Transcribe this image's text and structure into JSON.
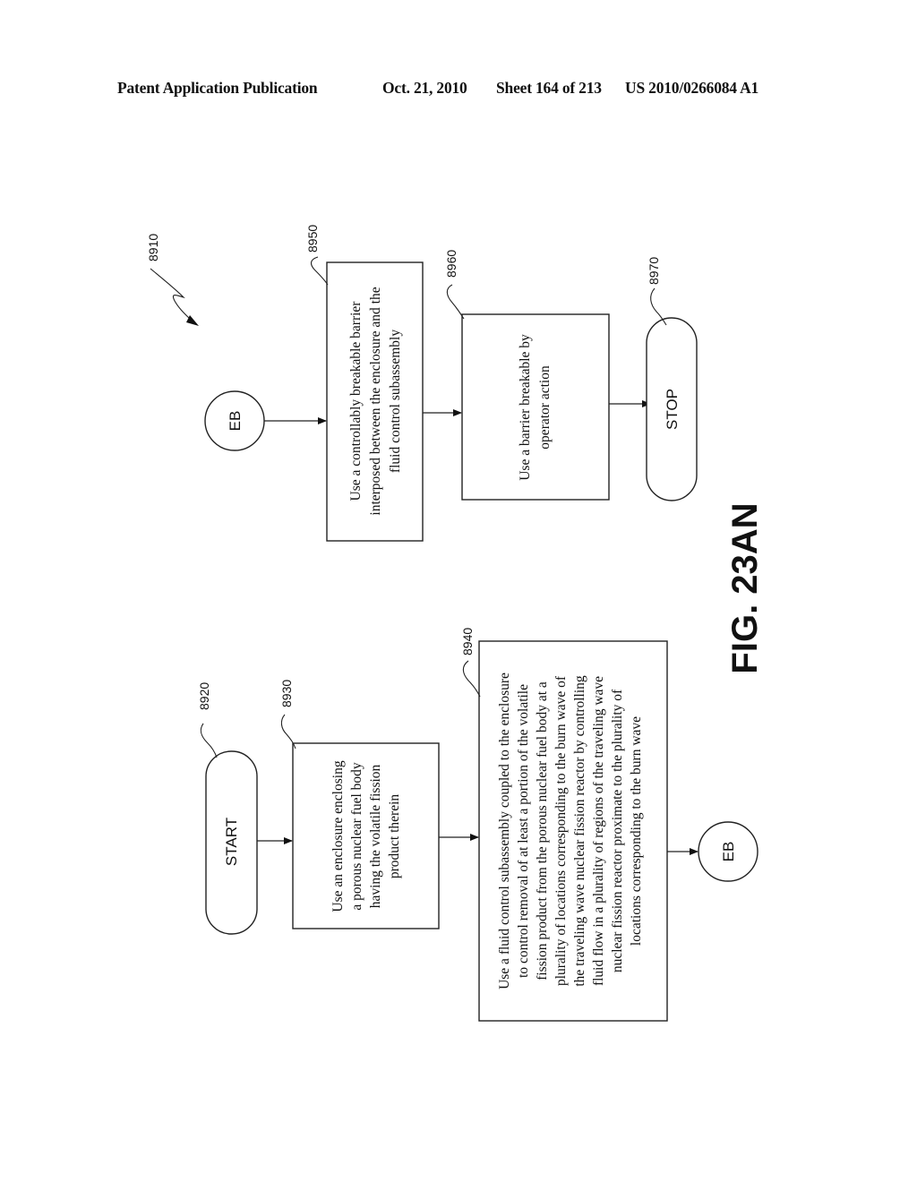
{
  "header": {
    "publication": "Patent Application Publication",
    "date": "Oct. 21, 2010",
    "sheet": "Sheet 164 of 213",
    "number": "US 2010/0266084 A1"
  },
  "figure": {
    "label": "FIG. 23AN",
    "ref": "8910"
  },
  "flow_left": {
    "start": {
      "ref": "8920",
      "label": "START"
    },
    "step_8930": {
      "ref": "8930",
      "lines": [
        "Use an enclosure enclosing",
        "a porous nuclear fuel body",
        "having the volatile fission",
        "product therein"
      ]
    },
    "step_8940": {
      "ref": "8940",
      "lines": [
        "Use a fluid control subassembly coupled to the enclosure",
        "to control removal of at least a portion of the volatile",
        "fission product from the porous nuclear fuel body at a",
        "plurality of locations corresponding to the burn wave of",
        "the traveling wave nuclear fission reactor by controlling",
        "fluid flow in a plurality of regions of the traveling wave",
        "nuclear fission reactor proximate to the plurality of",
        "locations corresponding to the burn wave"
      ]
    },
    "connector_out": {
      "label": "EB"
    }
  },
  "flow_right": {
    "connector_in": {
      "label": "EB"
    },
    "step_8950": {
      "ref": "8950",
      "lines": [
        "Use a controllably breakable barrier",
        "interposed between the enclosure and the",
        "fluid control subassembly"
      ]
    },
    "step_8960": {
      "ref": "8960",
      "lines": [
        "Use a barrier breakable by",
        "operator action"
      ]
    },
    "stop": {
      "ref": "8970",
      "label": "STOP"
    }
  }
}
